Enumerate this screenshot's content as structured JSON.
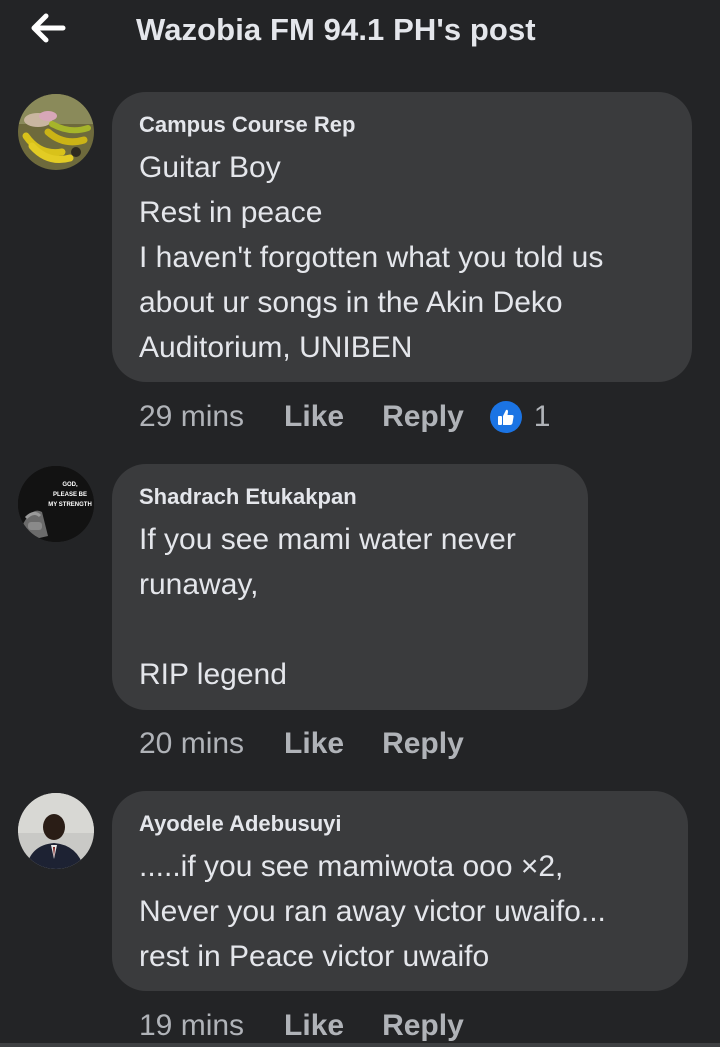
{
  "header": {
    "title": "Wazobia FM 94.1 PH's post",
    "back_icon": "arrow-left-icon"
  },
  "comments": [
    {
      "author": "Campus Course Rep",
      "lines": [
        "Guitar Boy",
        "Rest in peace",
        "I haven't forgotten what you told us",
        "about ur songs in the Akin Deko",
        "Auditorium, UNIBEN"
      ],
      "time": "29 mins",
      "like_label": "Like",
      "reply_label": "Reply",
      "reaction_icon": "thumbs-up-icon",
      "reaction_count": "1"
    },
    {
      "author": "Shadrach Etukakpan",
      "avatar_text": [
        "GOD,",
        "PLEASE BE",
        "MY STRENGTH"
      ],
      "lines": [
        "If you see mami water never",
        "runaway,",
        "",
        "RIP legend"
      ],
      "time": "20 mins",
      "like_label": "Like",
      "reply_label": "Reply"
    },
    {
      "author": "Ayodele Adebusuyi",
      "lines": [
        ".....if you see mamiwota ooo ×2,",
        "Never you ran away victor uwaifo...",
        "rest in Peace victor uwaifo"
      ],
      "time": "19 mins",
      "like_label": "Like",
      "reply_label": "Reply"
    }
  ],
  "colors": {
    "background": "#232426",
    "bubble": "#3a3b3d",
    "text": "#e4e6eb",
    "secondary_text": "#b0b3b8",
    "like_blue": "#1b74e4"
  }
}
